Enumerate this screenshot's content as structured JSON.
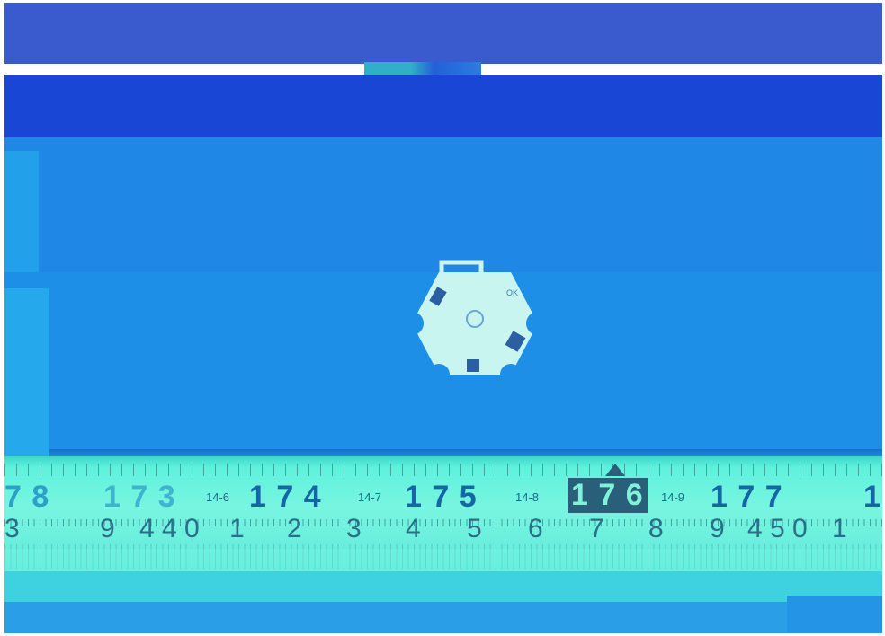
{
  "scene": {
    "colors": {
      "top_band": "#3a5fd0",
      "dark_band": "#1a45d8",
      "mid_background": "#1f8fe3",
      "lower_background": "#1d8ee6",
      "board": "#c8f5f0",
      "ruler": "#6ff2dc",
      "ruler_text": "#1566a5",
      "highlight": "#2a5f7a"
    },
    "ruler": {
      "sub_labels": [
        "14-6",
        "14-7",
        "14-8",
        "14-9"
      ],
      "major_labels": [
        "7 8",
        "1 7 3",
        "1 7 4",
        "1 7 5",
        "1 7 6",
        "1 7 7",
        "1"
      ],
      "mm_labels": [
        "3",
        "9",
        "4 4 0",
        "1",
        "2",
        "3",
        "4",
        "5",
        "6",
        "7",
        "8",
        "9",
        "4 5 0",
        "1"
      ]
    }
  }
}
